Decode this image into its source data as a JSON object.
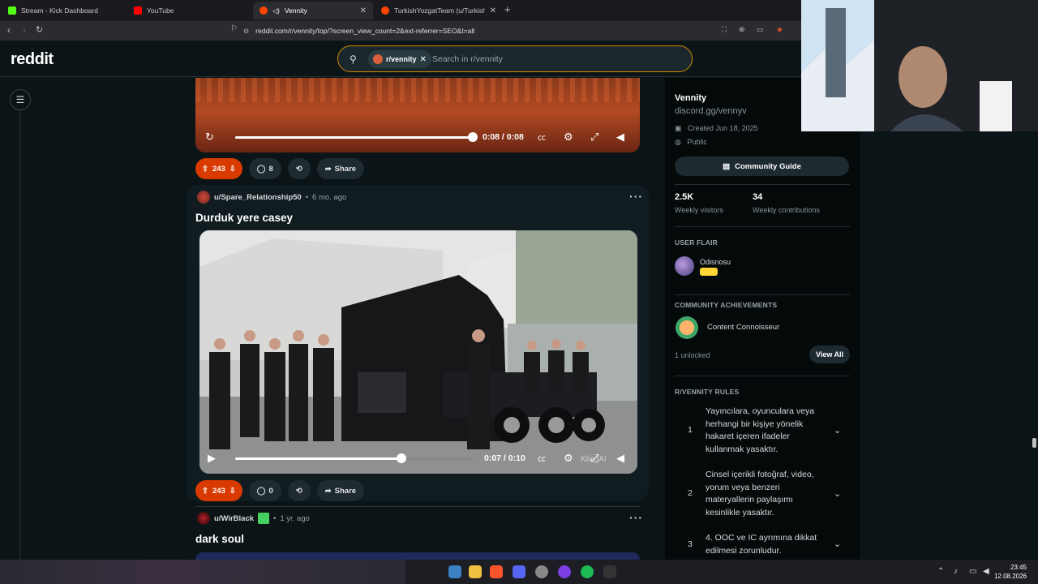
{
  "browser": {
    "tabs": [
      {
        "title": "Stream - Kick Dashboard",
        "active": false
      },
      {
        "title": "YouTube",
        "active": false
      },
      {
        "title": "Vennity",
        "active": true
      },
      {
        "title": "TurkishYozgatTeam (u/TurkishYozgat",
        "active": false
      }
    ],
    "url": "reddit.com/r/vennity/top/?screen_view_count=2&ext-referrer=SEO&t=all"
  },
  "header": {
    "logo": "reddit",
    "search_chip": "r/vennity",
    "search_placeholder": "Search in r/vennity"
  },
  "post_prev": {
    "video_time": "0:08 / 0:08",
    "progress": 1.0,
    "votes": "243",
    "comments": "8",
    "share_label": "Share"
  },
  "post1": {
    "author": "u/Spare_Relationship50",
    "age": "6 mo. ago",
    "title": "Durduk yere casey",
    "video_time": "0:07 / 0:10",
    "progress": 0.7,
    "watermark": "KlingAI",
    "votes": "243",
    "comments": "0",
    "share_label": "Share"
  },
  "post2": {
    "author": "u/WirBlack",
    "age": "1 yr. ago",
    "title": "dark soul"
  },
  "sidebar": {
    "community_name": "Vennity",
    "community_link": "discord.gg/vennyv",
    "created": "Created Jun 18, 2025",
    "visibility": "Public",
    "guide_button": "Community Guide",
    "stats": [
      {
        "value": "2.5K",
        "label": "Weekly visitors"
      },
      {
        "value": "34",
        "label": "Weekly contributions"
      }
    ],
    "user_flair_heading": "USER FLAIR",
    "flair_user": "Odisnosu",
    "achievements_heading": "COMMUNITY ACHIEVEMENTS",
    "achievement": "Content Connoisseur",
    "unlocked": "1 unlocked",
    "view_all": "View All",
    "rules_heading": "R/VENNITY RULES",
    "rules": [
      {
        "num": "1",
        "text": "Yayıncılara, oyunculara veya herhangi bir kişiye yönelik hakaret içeren ifadeler kullanmak yasaktır."
      },
      {
        "num": "2",
        "text": "Cinsel içerikli fotoğraf, video, yorum veya benzeri materyallerin paylaşımı kesinlikle yasaktır."
      },
      {
        "num": "3",
        "text": "4. OOC ve IC ayrımına dikkat edilmesi zorunludur."
      }
    ]
  },
  "taskbar": {
    "time": "23:45",
    "date": "12.08.2026"
  },
  "colors": {
    "upvote_active": "#d93a00",
    "search_border": "#d68a00",
    "background": "#0b1416"
  }
}
